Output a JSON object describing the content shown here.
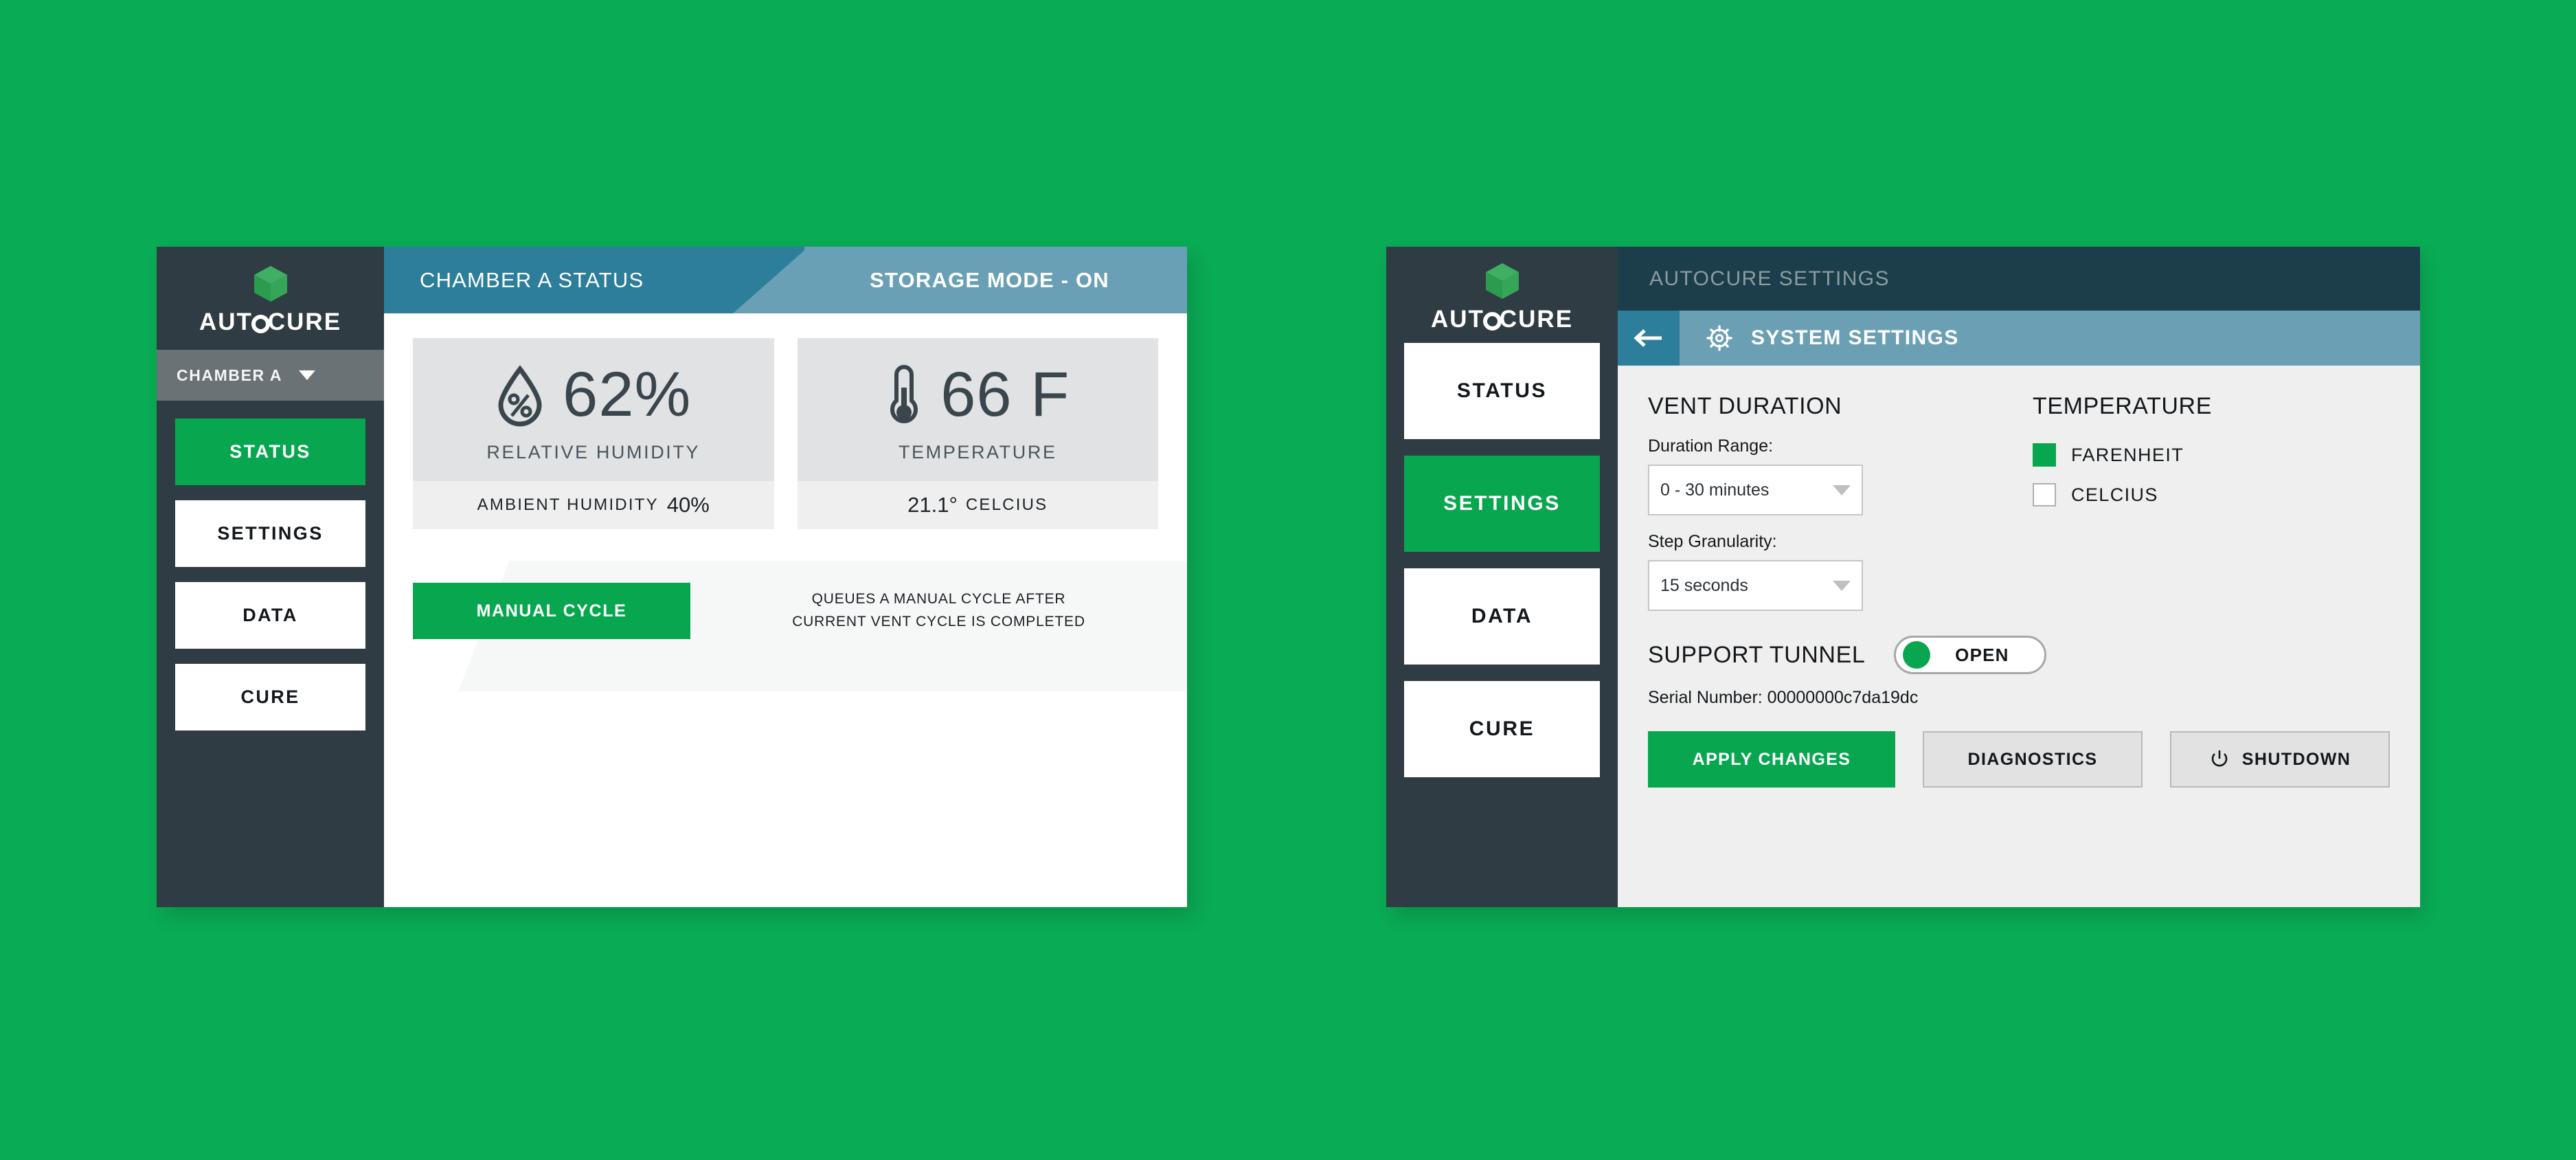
{
  "theme": {
    "background_green": "#0AAB55",
    "accent_green": "#09A650",
    "sidebar_dark": "#2F3C44",
    "header_blue": "#2C7E9B",
    "header_blue_light": "#69A0B5",
    "settings_header_teal": "#1C3E4B",
    "card_gray": "#E0E2E3"
  },
  "status_screen": {
    "brand": {
      "name_a": "AUT",
      "name_b": "CURE",
      "logo_icon": "cube-icon"
    },
    "chamber_selector": {
      "label": "CHAMBER A",
      "icon": "chevron-down-icon"
    },
    "nav": [
      {
        "label": "STATUS",
        "active": true
      },
      {
        "label": "SETTINGS",
        "active": false
      },
      {
        "label": "DATA",
        "active": false
      },
      {
        "label": "CURE",
        "active": false
      }
    ],
    "header": {
      "title": "CHAMBER A STATUS",
      "mode_badge": "STORAGE MODE - ON"
    },
    "metrics": [
      {
        "icon": "humidity-drop-icon",
        "value": "62%",
        "label": "RELATIVE HUMIDITY",
        "sub_label": "AMBIENT HUMIDITY",
        "sub_value": "40%"
      },
      {
        "icon": "thermometer-icon",
        "value": "66 F",
        "label": "TEMPERATURE",
        "sub_label": "CELCIUS",
        "sub_value": "21.1°"
      }
    ],
    "action": {
      "button_label": "MANUAL CYCLE",
      "note_line1": "QUEUES A MANUAL CYCLE AFTER",
      "note_line2": "CURRENT VENT CYCLE IS COMPLETED"
    }
  },
  "settings_screen": {
    "brand": {
      "name_a": "AUT",
      "name_b": "CURE",
      "logo_icon": "cube-icon"
    },
    "nav": [
      {
        "label": "STATUS",
        "active": false
      },
      {
        "label": "SETTINGS",
        "active": true
      },
      {
        "label": "DATA",
        "active": false
      },
      {
        "label": "CURE",
        "active": false
      }
    ],
    "topbar_title": "AUTOCURE SETTINGS",
    "subbar": {
      "back_icon": "arrow-left-icon",
      "gear_icon": "gear-icon",
      "title": "SYSTEM SETTINGS"
    },
    "vent_duration": {
      "heading": "VENT DURATION",
      "duration_range_label": "Duration Range:",
      "duration_range_value": "0 - 30 minutes",
      "step_granularity_label": "Step Granularity:",
      "step_granularity_value": "15 seconds"
    },
    "temperature": {
      "heading": "TEMPERATURE",
      "options": [
        {
          "label": "FARENHEIT",
          "checked": true
        },
        {
          "label": "CELCIUS",
          "checked": false
        }
      ]
    },
    "support_tunnel": {
      "heading": "SUPPORT TUNNEL",
      "toggle_state": "OPEN",
      "serial": "Serial Number: 00000000c7da19dc"
    },
    "buttons": [
      {
        "label": "APPLY CHANGES",
        "style": "primary",
        "icon": null
      },
      {
        "label": "DIAGNOSTICS",
        "style": "secondary",
        "icon": null
      },
      {
        "label": "SHUTDOWN",
        "style": "secondary",
        "icon": "power-icon"
      }
    ]
  }
}
